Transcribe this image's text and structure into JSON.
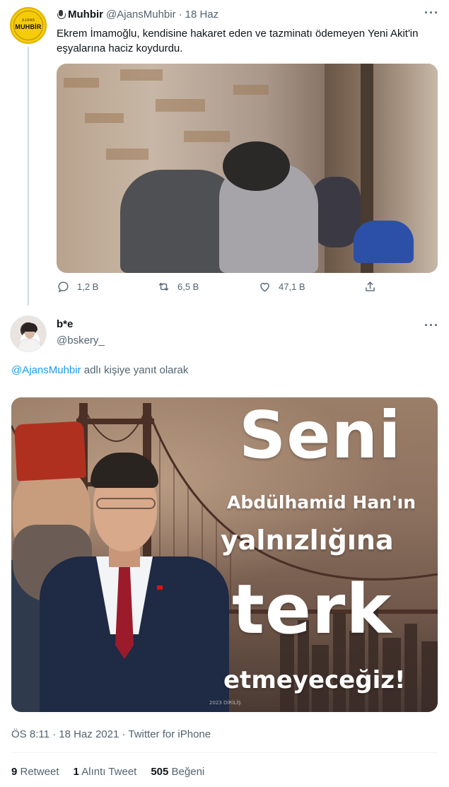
{
  "tweet1": {
    "name": "Muhbir",
    "handle": "@AjansMuhbir",
    "separator": "·",
    "date": "18 Haz",
    "avatar_top": "AJANS",
    "avatar_main": "MUHBİR",
    "text": "Ekrem İmamoğlu, kendisine hakaret eden ve tazminatı ödemeyen Yeni Akit'in eşyalarına haciz koydurdu.",
    "more": "···",
    "actions": {
      "reply_icon": "reply-icon",
      "reply_count": "1,2 B",
      "retweet_icon": "retweet-icon",
      "retweet_count": "6,5 B",
      "like_icon": "like-icon",
      "like_count": "47,1 B",
      "share_icon": "share-icon"
    }
  },
  "tweet2": {
    "name": "b*e",
    "handle": "@bskery_",
    "more": "···",
    "reply_mention": "@AjansMuhbir",
    "reply_suffix": " adlı kişiye yanıt olarak",
    "poster": {
      "line1": "Seni",
      "line2": "Abdülhamid Han'ın",
      "line3": "yalnızlığına",
      "line4": "terk",
      "line5": "etmeyeceğiz!",
      "watermark": "2023 DİRİLİŞ"
    },
    "timestamp": "ÖS 8:11 · 18 Haz 2021 · Twitter for iPhone",
    "stats": {
      "retweets_count": "9",
      "retweets_label": " Retweet",
      "quotes_count": "1",
      "quotes_label": " Alıntı Tweet",
      "likes_count": "505",
      "likes_label": " Beğeni"
    }
  },
  "colors": {
    "link": "#1d9bf0",
    "secondary_text": "#536471",
    "primary_text": "#0f1419"
  }
}
